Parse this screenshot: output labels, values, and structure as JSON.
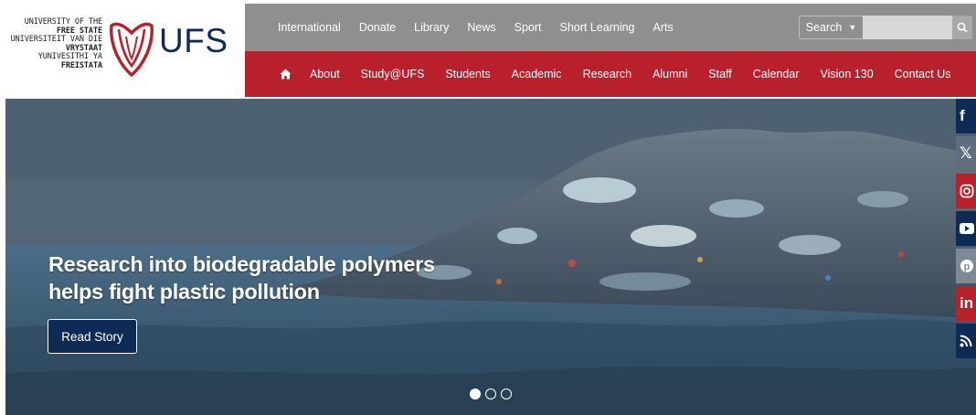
{
  "logo": {
    "line1": "UNIVERSITY OF THE",
    "line2": "FREE STATE",
    "line3": "UNIVERSITEIT VAN DIE",
    "line4": "VRYSTAAT",
    "line5": "YUNIVESITHI YA",
    "line6": "FREISTATA",
    "wordmark": "UFS",
    "emblem_color": "#b8202c"
  },
  "top_nav": {
    "items": [
      "International",
      "Donate",
      "Library",
      "News",
      "Sport",
      "Short Learning",
      "Arts"
    ],
    "search_label": "Search",
    "search_placeholder": "",
    "search_go_icon": "search-icon",
    "bar_color": "#8f8f8f"
  },
  "main_nav": {
    "home_icon": "home-icon",
    "items": [
      "About",
      "Study@UFS",
      "Students",
      "Academic",
      "Research",
      "Alumni",
      "Staff",
      "Calendar",
      "Vision 130",
      "Contact Us"
    ],
    "bar_color": "#b8202c"
  },
  "hero": {
    "headline_line1": "Research into biodegradable polymers",
    "headline_line2": "helps fight plastic pollution",
    "button_label": "Read Story",
    "carousel_slides": 3,
    "carousel_active": 1
  },
  "social": {
    "icons": [
      "facebook-icon",
      "x-icon",
      "instagram-icon",
      "youtube-icon",
      "pinterest-icon",
      "linkedin-icon",
      "rss-icon"
    ]
  },
  "colors": {
    "navy": "#0d2b55",
    "red": "#b8202c",
    "grey": "#8f8f8f"
  }
}
